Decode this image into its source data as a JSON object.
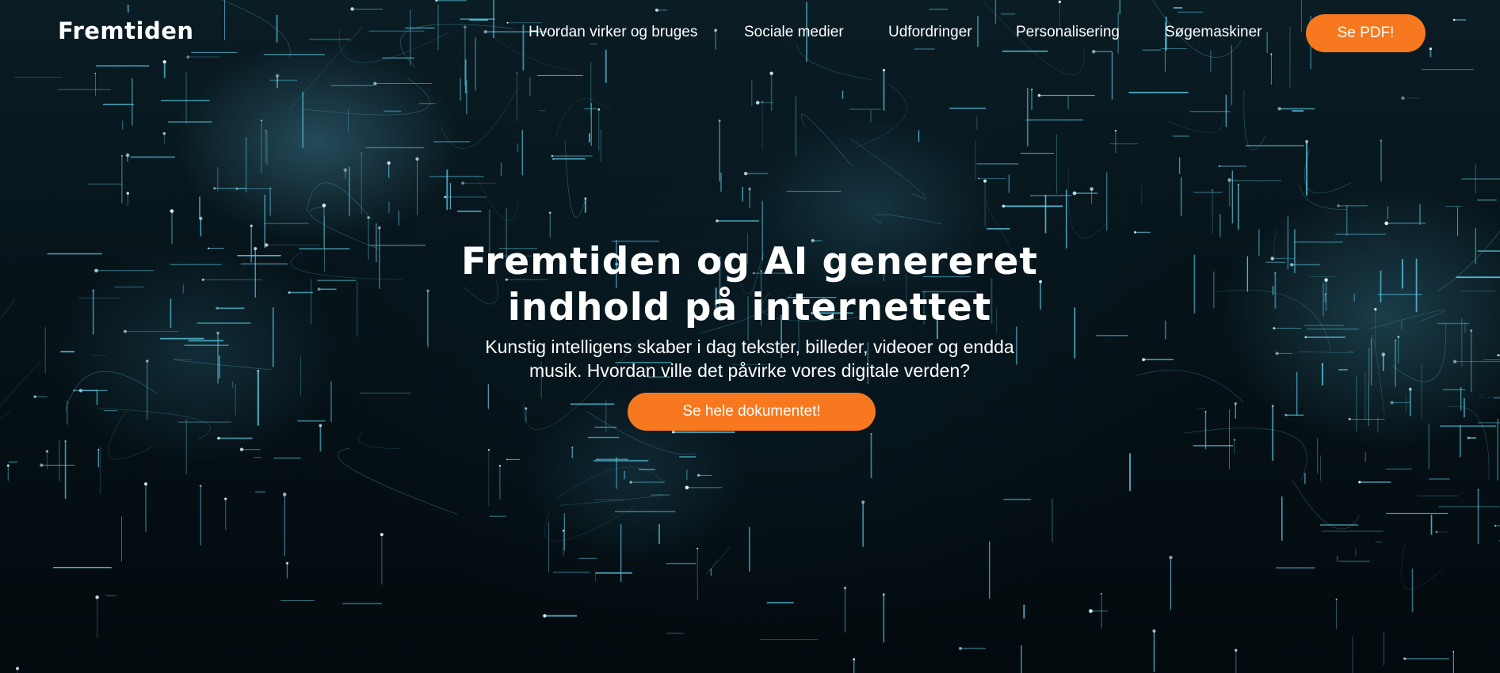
{
  "brand": {
    "logo": "Fremtiden"
  },
  "nav": {
    "links": [
      {
        "label": "Hvordan virker og bruges"
      },
      {
        "label": "Sociale medier"
      },
      {
        "label": "Udfordringer"
      },
      {
        "label": "Personalisering"
      },
      {
        "label": "Søgemaskiner"
      }
    ],
    "cta_label": "Se PDF!"
  },
  "hero": {
    "title_line1": "Fremtiden og AI genereret",
    "title_line2": "indhold på internettet",
    "subtitle_line1": "Kunstig intelligens skaber i dag tekster, billeder, videoer og endda",
    "subtitle_line2": "musik. Hvordan ville det påvirke vores digitale verden?",
    "cta_label": "Se hele dokumentet!"
  },
  "colors": {
    "accent": "#f7781e",
    "background": "#02080b",
    "network_glow": "#5fd4f0"
  }
}
